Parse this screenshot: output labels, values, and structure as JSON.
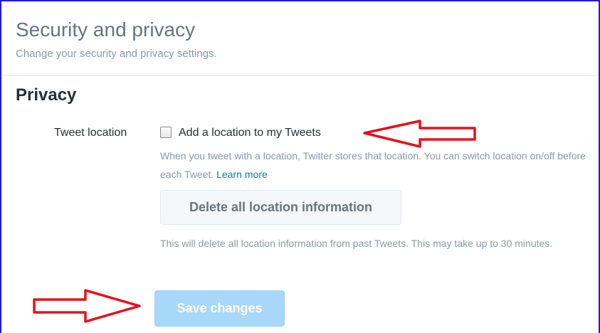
{
  "header": {
    "title": "Security and privacy",
    "subtitle": "Change your security and privacy settings."
  },
  "privacy": {
    "section_title": "Privacy",
    "tweet_location": {
      "label": "Tweet location",
      "checkbox_label": "Add a location to my Tweets",
      "checked": false,
      "help_text": "When you tweet with a location, Twitter stores that location. You can switch location on/off before each Tweet.",
      "learn_more": "Learn more"
    },
    "delete_button_label": "Delete all location information",
    "delete_help_text": "This will delete all location information from past Tweets. This may take up to 30 minutes."
  },
  "save_button_label": "Save changes",
  "annotations": {
    "arrow_color": "#e8101a"
  },
  "colors": {
    "frame_border": "#1a1ae6",
    "link": "#0084b4",
    "save_button_bg": "#a7d7f9"
  }
}
